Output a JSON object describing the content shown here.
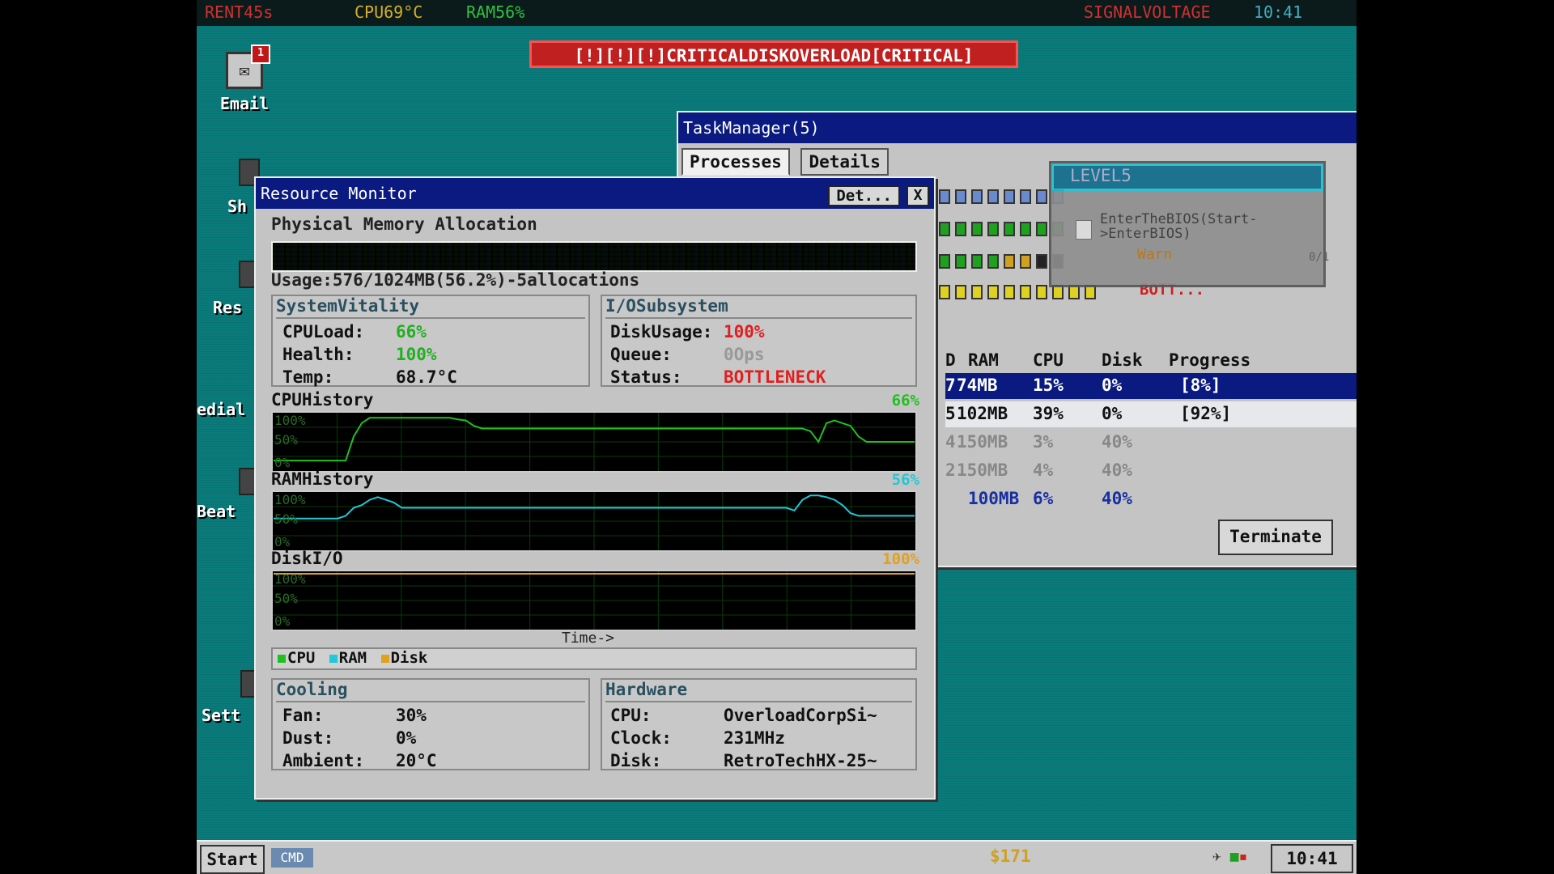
{
  "topbar": {
    "rent": "RENT45s",
    "cpu": "CPU69°C",
    "ram": "RAM56%",
    "signal": "SIGNALVOLTAGE",
    "time": "10:41"
  },
  "alert": "[!][!][!]CRITICALDISKOVERLOAD[CRITICAL]",
  "desktop": {
    "email_label": "Email",
    "email_badge": "1",
    "labels": [
      "Sh",
      "Res",
      "edial",
      "Beat",
      "Sett"
    ]
  },
  "task_manager": {
    "title": "TaskManager(5)",
    "tabs": [
      "Processes",
      "Details"
    ],
    "level_title": "LEVEL5",
    "level_task": "EnterTheBIOS(Start->EnterBIOS)",
    "level_warn": "Warn",
    "level_progress": "0/1",
    "bott_label": "BOTT...",
    "columns": [
      "D",
      "RAM",
      "CPU",
      "Disk",
      "Progress"
    ],
    "rows": [
      {
        "id": "7",
        "ram": "74MB",
        "cpu": "15%",
        "disk": "0%",
        "progress": "[8%]"
      },
      {
        "id": "5",
        "ram": "102MB",
        "cpu": "39%",
        "disk": "0%",
        "progress": "[92%]"
      },
      {
        "id": "4",
        "ram": "150MB",
        "cpu": "3%",
        "disk": "40%",
        "progress": ""
      },
      {
        "id": "2",
        "ram": "150MB",
        "cpu": "4%",
        "disk": "40%",
        "progress": ""
      },
      {
        "id": "",
        "ram": "100MB",
        "cpu": "6%",
        "disk": "40%",
        "progress": ""
      }
    ],
    "terminate": "Terminate"
  },
  "resource_monitor": {
    "title": "Resource Monitor",
    "det_button": "Det...",
    "close_button": "X",
    "mem_heading": "Physical Memory Allocation",
    "usage": "Usage:576/1024MB(56.2%)-5allocations",
    "vitality": {
      "title": "SystemVitality",
      "cpu_label": "CPULoad:",
      "cpu": "66%",
      "health_label": "Health:",
      "health": "100%",
      "temp_label": "Temp:",
      "temp": "68.7°C"
    },
    "io": {
      "title": "I/OSubsystem",
      "disk_label": "DiskUsage:",
      "disk": "100%",
      "queue_label": "Queue:",
      "queue": "0Ops",
      "status_label": "Status:",
      "status": "BOTTLENECK"
    },
    "charts": {
      "cpu": {
        "name": "CPUHistory",
        "pct": "66%",
        "values": [
          15,
          15,
          15,
          15,
          15,
          15,
          15,
          15,
          15,
          15,
          60,
          85,
          95,
          95,
          95,
          95,
          95,
          95,
          95,
          95,
          95,
          95,
          95,
          92,
          90,
          80,
          75,
          75,
          75,
          75,
          75,
          75,
          75,
          75,
          75,
          75,
          75,
          75,
          75,
          75,
          75,
          75,
          75,
          75,
          75,
          75,
          75,
          75,
          75,
          75,
          75,
          75,
          75,
          75,
          75,
          75,
          75,
          75,
          75,
          75,
          75,
          75,
          75,
          75,
          75,
          75,
          75,
          70,
          50,
          85,
          90,
          85,
          80,
          60,
          50,
          50,
          50,
          50,
          50,
          50,
          50
        ]
      },
      "ram": {
        "name": "RAMHistory",
        "pct": "56%",
        "values": [
          55,
          55,
          55,
          55,
          55,
          55,
          55,
          55,
          55,
          60,
          75,
          80,
          90,
          95,
          90,
          85,
          75,
          75,
          75,
          75,
          75,
          75,
          75,
          75,
          75,
          75,
          75,
          75,
          75,
          75,
          75,
          75,
          75,
          75,
          75,
          75,
          75,
          75,
          75,
          75,
          75,
          75,
          75,
          75,
          75,
          75,
          75,
          75,
          75,
          75,
          75,
          75,
          75,
          75,
          75,
          75,
          75,
          75,
          75,
          75,
          75,
          75,
          75,
          75,
          75,
          70,
          90,
          98,
          98,
          95,
          90,
          80,
          65,
          60,
          60,
          60,
          60,
          60,
          60,
          60,
          60
        ]
      },
      "disk": {
        "name": "DiskI/O",
        "pct": "100%",
        "values": [
          100,
          100,
          100,
          100,
          100,
          100,
          100,
          100,
          100,
          100,
          100,
          100,
          100,
          100,
          100,
          100,
          100,
          100,
          100,
          100,
          100,
          100,
          100,
          100,
          100,
          100,
          100,
          100,
          100,
          100,
          100,
          100,
          100,
          100,
          100,
          100,
          100,
          100,
          100,
          100,
          100,
          100,
          100,
          100,
          100,
          100,
          100,
          100,
          100,
          100,
          100,
          100,
          100,
          100,
          100,
          100,
          100,
          100,
          100,
          100,
          100,
          100,
          100,
          100,
          100,
          100,
          100,
          100,
          100,
          100,
          100,
          100,
          100,
          100,
          100,
          100,
          100,
          100,
          100,
          100,
          100
        ]
      },
      "axis_labels": [
        "100%",
        "50%",
        "0%"
      ],
      "time_label": "Time->"
    },
    "legend": [
      "CPU",
      "RAM",
      "Disk"
    ],
    "colors": {
      "cpu": "#20c020",
      "ram": "#20c8d8",
      "disk": "#e0a020"
    },
    "cooling": {
      "title": "Cooling",
      "fan_label": "Fan:",
      "fan": "30%",
      "dust_label": "Dust:",
      "dust": "0%",
      "ambient_label": "Ambient:",
      "ambient": "20°C"
    },
    "hardware": {
      "title": "Hardware",
      "cpu_label": "CPU:",
      "cpu": "OverloadCorpSi~",
      "clock_label": "Clock:",
      "clock": "231MHz",
      "disk_label": "Disk:",
      "disk": "RetroTechHX-25~"
    }
  },
  "taskbar": {
    "start": "Start",
    "cmd": "CMD",
    "money": "$171",
    "clock": "10:41"
  }
}
